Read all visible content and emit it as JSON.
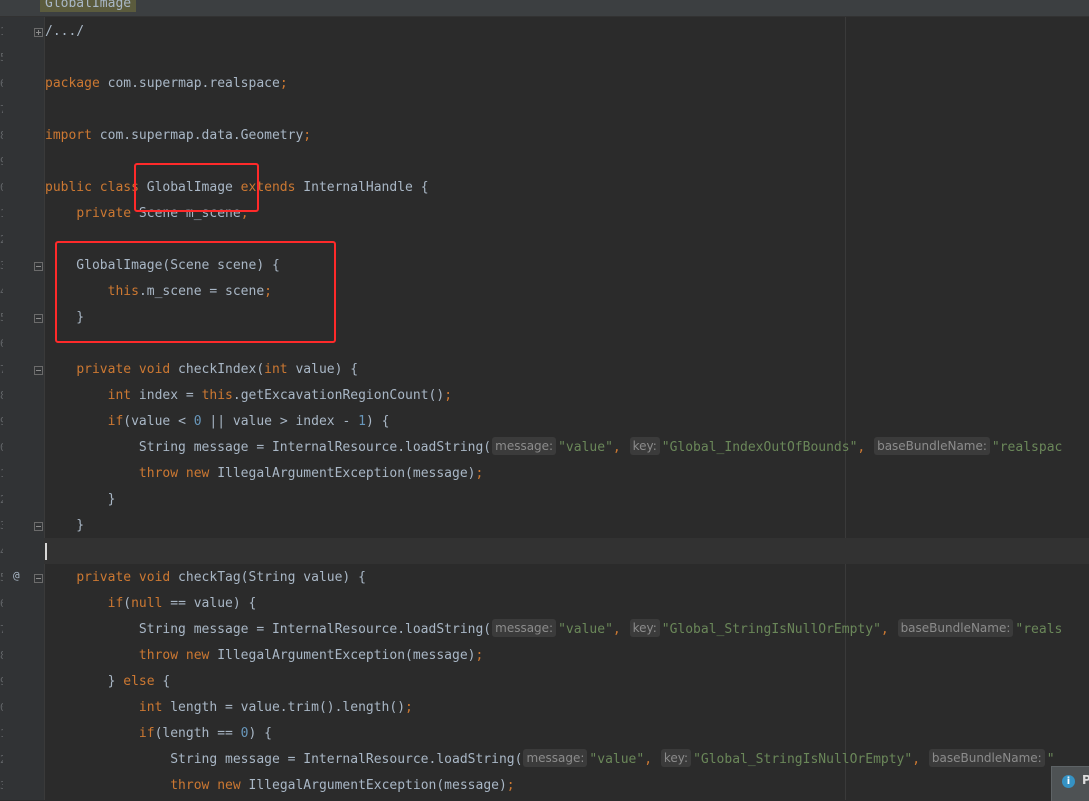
{
  "tab_title": "GlobalImage",
  "gutter_marker": "@",
  "popup_text": "P",
  "info_icon_glyph": "i",
  "colors": {
    "background": "#2b2b2b",
    "keyword": "#cc7832",
    "string": "#6a8759",
    "number": "#6897bb",
    "default_text": "#a9b7c6",
    "highlight_box": "#ff2a2a"
  },
  "code": {
    "fold_header": "/.../",
    "l_package": {
      "kw": "package",
      "rest": " com.supermap.realspace",
      "semi": ";"
    },
    "l_import": {
      "kw": "import",
      "rest": " com.supermap.data.Geometry",
      "semi": ";"
    },
    "l_class": {
      "kw1": "public class",
      "name": " GlobalImage ",
      "kw2": "extends",
      "rest": " InternalHandle {"
    },
    "l_field": {
      "indent": "    ",
      "kw": "private",
      "rest": " Scene m_scene",
      "semi": ";"
    },
    "l_ctor": {
      "text": "    GlobalImage(Scene scene) {"
    },
    "l_ctor_body": {
      "indent": "        ",
      "kw": "this",
      "rest": ".m_scene = scene",
      "semi": ";"
    },
    "l_ctor_close": {
      "text": "    }"
    },
    "l_ci_sig": {
      "indent": "    ",
      "kw1": "private void",
      "mid1": " checkIndex(",
      "kw2": "int",
      "rest": " value) {"
    },
    "l_ci_index": {
      "indent": "        ",
      "kw1": "int",
      "mid1": " index = ",
      "kw2": "this",
      "rest": ".getExcavationRegionCount()",
      "semi": ";"
    },
    "l_ci_if": {
      "indent": "        ",
      "kw": "if",
      "p1": "(value < ",
      "n1": "0",
      "p2": " || value > index - ",
      "n2": "1",
      "p3": ") {"
    },
    "l_ci_msg": {
      "pre": "            String message = InternalResource.loadString(",
      "h1": "message:",
      "s1": "\"value\"",
      "c1": ", ",
      "h2": "key:",
      "s2": "\"Global_IndexOutOfBounds\"",
      "c2": ", ",
      "h3": "baseBundleName:",
      "s3": "\"realspac"
    },
    "l_ci_throw": {
      "indent": "            ",
      "kw": "throw new",
      "rest": " IllegalArgumentException(message)",
      "semi": ";"
    },
    "l_ci_close1": {
      "text": "        }"
    },
    "l_ci_close2": {
      "text": "    }"
    },
    "l_ct_sig": {
      "indent": "    ",
      "kw": "private void",
      "rest": " checkTag(String value) {"
    },
    "l_ct_if": {
      "indent": "        ",
      "kw1": "if",
      "p1": "(",
      "kw2": "null",
      "rest": " == value) {"
    },
    "l_ct_msg": {
      "pre": "            String message = InternalResource.loadString(",
      "h1": "message:",
      "s1": "\"value\"",
      "c1": ", ",
      "h2": "key:",
      "s2": "\"Global_StringIsNullOrEmpty\"",
      "c2": ", ",
      "h3": "baseBundleName:",
      "s3": "\"reals"
    },
    "l_ct_throw": {
      "indent": "            ",
      "kw": "throw new",
      "rest": " IllegalArgumentException(message)",
      "semi": ";"
    },
    "l_ct_else": {
      "indent": "        ",
      "pre": "} ",
      "kw": "else",
      "rest": " {"
    },
    "l_ct_len": {
      "indent": "            ",
      "kw": "int",
      "rest": " length = value.trim().length()",
      "semi": ";"
    },
    "l_ct_if2": {
      "indent": "            ",
      "kw": "if",
      "p1": "(length == ",
      "n1": "0",
      "p2": ") {"
    },
    "l_ct_msg2": {
      "pre": "                String message = InternalResource.loadString(",
      "h1": "message:",
      "s1": "\"value\"",
      "c1": ", ",
      "h2": "key:",
      "s2": "\"Global_StringIsNullOrEmpty\"",
      "c2": ", ",
      "h3": "baseBundleName:",
      "s3": "\""
    },
    "l_ct_throw2": {
      "indent": "                ",
      "kw": "throw new",
      "rest": " IllegalArgumentException(message)",
      "semi": ";"
    }
  }
}
